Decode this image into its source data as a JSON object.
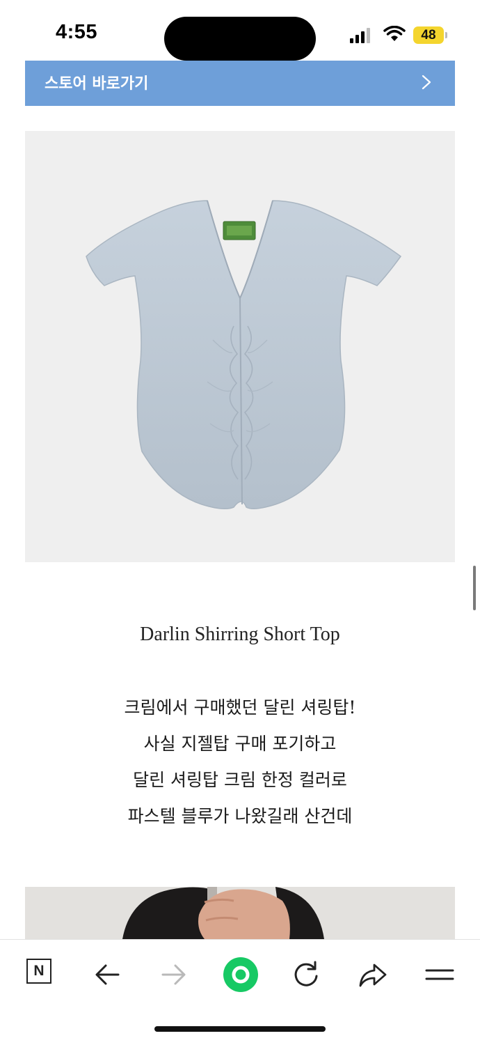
{
  "status_bar": {
    "time": "4:55",
    "battery": "48",
    "battery_color": "#f4d52e"
  },
  "store_banner": {
    "label": "스토어 바로가기",
    "background_color": "#6e9fd9"
  },
  "product": {
    "image_icon": "pastel-blue-shirring-top-photo",
    "image_color": "#bcc8d6",
    "name": "Darlin Shirring Short Top",
    "description_lines": [
      "크림에서 구매했던 달린 셔링탑!",
      "사실 지젤탑 구매 포기하고",
      "달린 셔링탑 크림 한정 컬러로",
      "파스텔 블루가 나왔길래 산건데"
    ]
  },
  "toolbar": {
    "n_logo": "N",
    "icons": [
      "naver-n-icon",
      "back-arrow-icon",
      "forward-arrow-icon",
      "green-dot-icon",
      "reload-icon",
      "share-icon",
      "menu-icon"
    ],
    "accent_color": "#17c964"
  }
}
